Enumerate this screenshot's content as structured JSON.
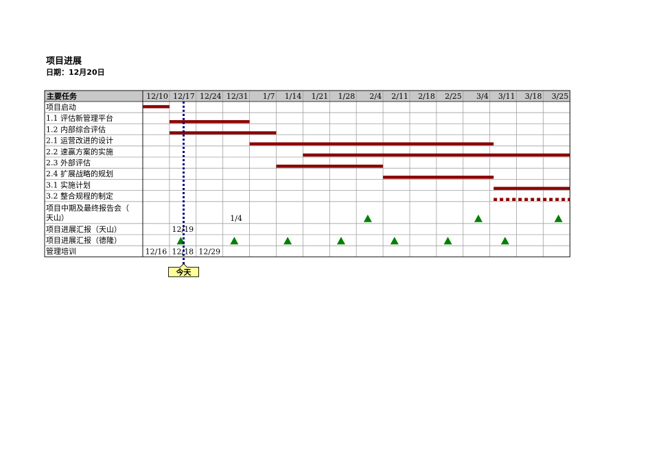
{
  "header": {
    "title": "项目进展",
    "date_label": "日期：12月20日"
  },
  "chart_data": {
    "type": "table",
    "column_header": "主要任务",
    "weeks": [
      "12/10",
      "12/17",
      "12/24",
      "12/31",
      "1/7",
      "1/14",
      "1/21",
      "1/28",
      "2/4",
      "2/11",
      "2/18",
      "2/25",
      "3/4",
      "3/11",
      "3/18",
      "3/25"
    ],
    "rows": [
      {
        "label": "项目启动",
        "tall": false
      },
      {
        "label": "1.1 评估新管理平台",
        "tall": false
      },
      {
        "label": "1.2 内部综合评估",
        "tall": false
      },
      {
        "label": "2.1 运营改进的设计",
        "tall": false
      },
      {
        "label": "2.2 速赢方案的实施",
        "tall": false
      },
      {
        "label": "2.3 外部评估",
        "tall": false
      },
      {
        "label": "2.4 扩展战略的规划",
        "tall": false
      },
      {
        "label": "3.1 实施计划",
        "tall": false
      },
      {
        "label": "3.2 整合规程的制定",
        "tall": false
      },
      {
        "label": "项目中期及最终报告会（天山）",
        "label_lines": [
          "项目中期及最终报告会（",
          "天山）"
        ],
        "tall": true
      },
      {
        "label": "项目进展汇报（天山）",
        "tall": false
      },
      {
        "label": "项目进展汇报（德隆）",
        "tall": false
      },
      {
        "label": "管理培训",
        "tall": false
      }
    ],
    "bars": [
      {
        "row": 0,
        "start": "12/10",
        "end": "12/17",
        "style": "solid"
      },
      {
        "row": 1,
        "start": "12/17",
        "end": "1/7",
        "style": "solid"
      },
      {
        "row": 2,
        "start": "12/17",
        "end": "1/14",
        "style": "solid"
      },
      {
        "row": 3,
        "start": "1/7",
        "end": "3/11",
        "style": "solid"
      },
      {
        "row": 4,
        "start": "1/21",
        "end": "4/1",
        "style": "solid"
      },
      {
        "row": 5,
        "start": "1/14",
        "end": "2/11",
        "style": "solid"
      },
      {
        "row": 6,
        "start": "2/11",
        "end": "3/11",
        "style": "solid"
      },
      {
        "row": 7,
        "start": "3/11",
        "end": "4/1",
        "style": "solid"
      },
      {
        "row": 8,
        "start": "3/11",
        "end": "4/1",
        "style": "dotted"
      }
    ],
    "milestones": [
      {
        "row": 9,
        "date": "2/7"
      },
      {
        "row": 9,
        "date": "3/7"
      },
      {
        "row": 9,
        "date": "3/28"
      },
      {
        "row": 11,
        "date": "12/20"
      },
      {
        "row": 11,
        "date": "1/3"
      },
      {
        "row": 11,
        "date": "1/17"
      },
      {
        "row": 11,
        "date": "1/31"
      },
      {
        "row": 11,
        "date": "2/14"
      },
      {
        "row": 11,
        "date": "2/28"
      },
      {
        "row": 11,
        "date": "3/14"
      }
    ],
    "date_labels": [
      {
        "row": 9,
        "week": "12/31",
        "text": "1/4"
      },
      {
        "row": 10,
        "week": "12/17",
        "text": "12/19"
      },
      {
        "row": 12,
        "week": "12/10",
        "text": "12/16"
      },
      {
        "row": 12,
        "week": "12/17",
        "text": "12/18"
      },
      {
        "row": 12,
        "week": "12/24",
        "text": "12/29"
      }
    ],
    "today": {
      "date": "12/20",
      "label": "今天"
    },
    "colors": {
      "bar": "#8b0000",
      "milestone": "#008000",
      "today_line": "#000080",
      "header_bg": "#c8c8c8",
      "grid": "#a0a0a0",
      "callout_bg": "#ffff99"
    }
  }
}
